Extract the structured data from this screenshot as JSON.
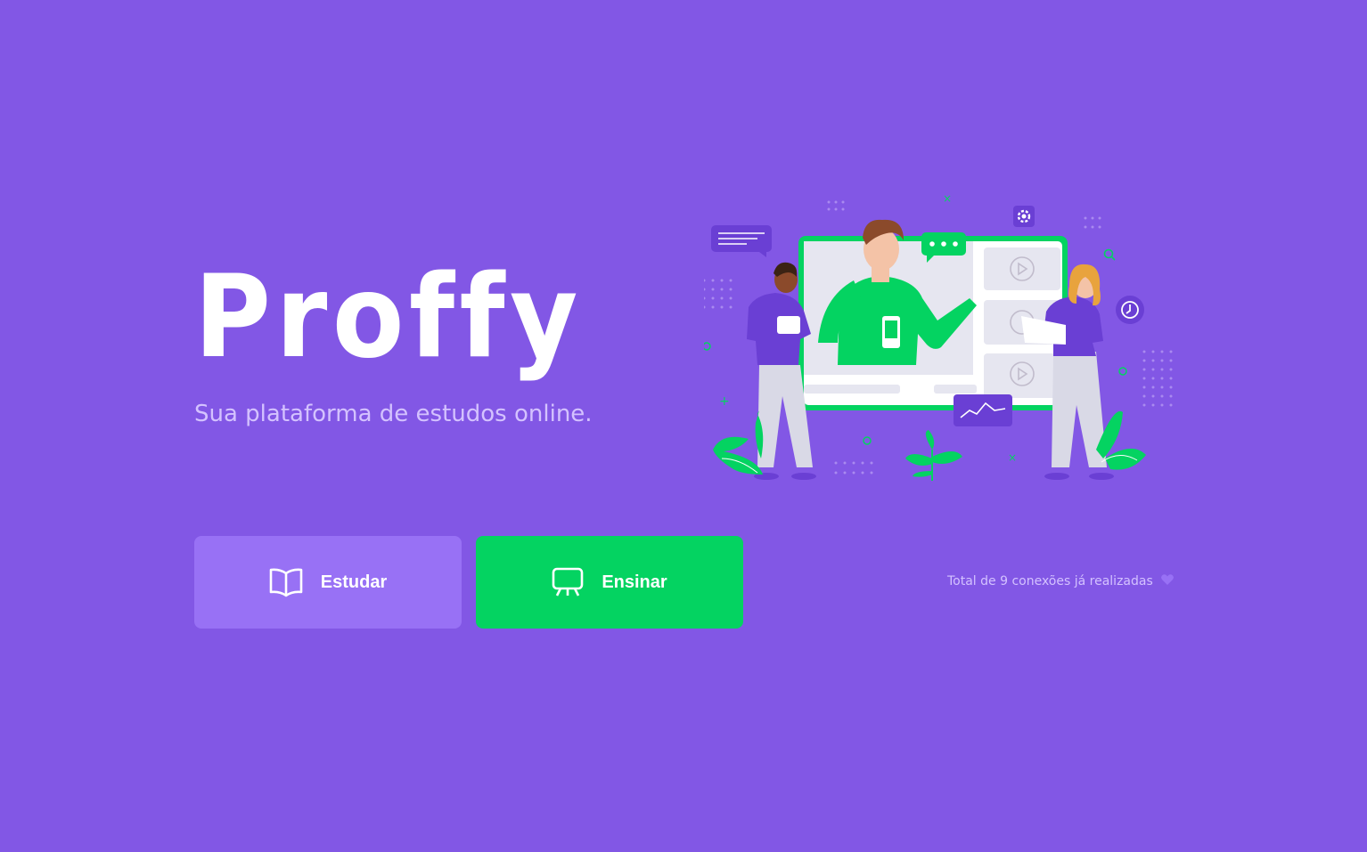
{
  "brand": {
    "name": "Proffy",
    "tagline": "Sua plataforma de estudos online."
  },
  "actions": {
    "study_label": "Estudar",
    "teach_label": "Ensinar"
  },
  "footer": {
    "connections_text": "Total de 9 conexões já realizadas"
  },
  "colors": {
    "background": "#8257e5",
    "study_button": "#9871f5",
    "teach_button": "#04d361",
    "text_muted": "#d4c2ff"
  },
  "icons": {
    "study": "book-open-icon",
    "teach": "presentation-board-icon",
    "connections": "purple-heart-icon"
  }
}
